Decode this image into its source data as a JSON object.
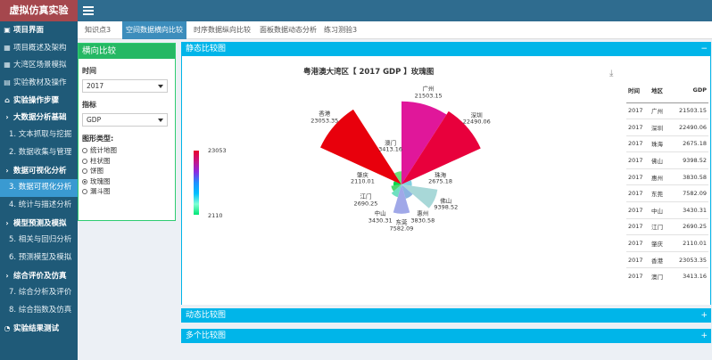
{
  "app": {
    "title": "虚拟仿真实验"
  },
  "sidebar": {
    "items": [
      {
        "label": "项目界面",
        "type": "section",
        "icon": "dashboard-icon"
      },
      {
        "label": "项目概述及架构",
        "type": "item",
        "icon": "grid-icon"
      },
      {
        "label": "大湾区场景模拟",
        "type": "item",
        "icon": "grid-icon"
      },
      {
        "label": "实验教材及操作",
        "type": "item",
        "icon": "image-icon"
      },
      {
        "label": "实验操作步骤",
        "type": "section",
        "icon": "bank-icon"
      },
      {
        "label": "大数据分析基础",
        "type": "section",
        "icon": "chevron-right-icon"
      },
      {
        "label": "1. 文本抓取与挖掘",
        "type": "sub"
      },
      {
        "label": "2. 数据收集与管理",
        "type": "sub"
      },
      {
        "label": "数据可视化分析",
        "type": "section",
        "icon": "chevron-right-icon"
      },
      {
        "label": "3. 数据可视化分析",
        "type": "sub",
        "active": true
      },
      {
        "label": "4. 统计与描述分析",
        "type": "sub"
      },
      {
        "label": "模型预测及模拟",
        "type": "section",
        "icon": "chevron-right-icon"
      },
      {
        "label": "5. 相关与回归分析",
        "type": "sub"
      },
      {
        "label": "6. 预测模型及模拟",
        "type": "sub"
      },
      {
        "label": "综合评价及仿真",
        "type": "section",
        "icon": "chevron-right-icon"
      },
      {
        "label": "7. 综合分析及评价",
        "type": "sub"
      },
      {
        "label": "8. 综合指数及仿真",
        "type": "sub"
      },
      {
        "label": "实验结果测试",
        "type": "section",
        "icon": "clock-icon"
      }
    ]
  },
  "tabs": [
    {
      "label": "知识点3"
    },
    {
      "label": "空间数据横向比较",
      "active": true
    },
    {
      "label": "时序数据纵向比较"
    },
    {
      "label": "面板数据动态分析"
    },
    {
      "label": "练习测验3"
    }
  ],
  "controls": {
    "header": "横向比较",
    "time_label": "时间",
    "time_value": "2017",
    "indicator_label": "指标",
    "indicator_value": "GDP",
    "chart_type_label": "图形类型:",
    "chart_types": [
      {
        "label": "统计地图",
        "selected": false
      },
      {
        "label": "柱状图",
        "selected": false
      },
      {
        "label": "饼图",
        "selected": false
      },
      {
        "label": "玫瑰图",
        "selected": true
      },
      {
        "label": "漏斗图",
        "selected": false
      }
    ]
  },
  "boxes": {
    "static": {
      "title": "静态比较图",
      "toggle": "−"
    },
    "dynamic": {
      "title": "动态比较图",
      "toggle": "+"
    },
    "multi": {
      "title": "多个比较图",
      "toggle": "+"
    }
  },
  "chart_data": {
    "type": "pie",
    "subtype": "rose",
    "title": "粤港澳大湾区【 2017 GDP 】玫瑰图",
    "legend": {
      "max": "23053",
      "min": "2110"
    },
    "slices": [
      {
        "name": "广州",
        "value": 21503.15,
        "color": "#e0179a"
      },
      {
        "name": "深圳",
        "value": 22490.06,
        "color": "#e8003c"
      },
      {
        "name": "珠海",
        "value": 2675.18,
        "color": "#7ecfe0"
      },
      {
        "name": "佛山",
        "value": 9398.52,
        "color": "#a8d8d8"
      },
      {
        "name": "惠州",
        "value": 3830.58,
        "color": "#8ab4e0"
      },
      {
        "name": "东莞",
        "value": 7582.09,
        "color": "#a0a8e8"
      },
      {
        "name": "中山",
        "value": 3430.31,
        "color": "#6fe0c0"
      },
      {
        "name": "江门",
        "value": 2690.25,
        "color": "#4ad86e"
      },
      {
        "name": "肇庆",
        "value": 2110.01,
        "color": "#00d84a"
      },
      {
        "name": "香港",
        "value": 23053.35,
        "color": "#e8000c"
      },
      {
        "name": "澳门",
        "value": 3413.16,
        "color": "#6ee07a"
      }
    ]
  },
  "table": {
    "headers": [
      "时间",
      "地区",
      "GDP"
    ],
    "rows": [
      [
        "2017",
        "广州",
        "21503.15"
      ],
      [
        "2017",
        "深圳",
        "22490.06"
      ],
      [
        "2017",
        "珠海",
        "2675.18"
      ],
      [
        "2017",
        "佛山",
        "9398.52"
      ],
      [
        "2017",
        "惠州",
        "3830.58"
      ],
      [
        "2017",
        "东莞",
        "7582.09"
      ],
      [
        "2017",
        "中山",
        "3430.31"
      ],
      [
        "2017",
        "江门",
        "2690.25"
      ],
      [
        "2017",
        "肇庆",
        "2110.01"
      ],
      [
        "2017",
        "香港",
        "23053.35"
      ],
      [
        "2017",
        "澳门",
        "3413.16"
      ]
    ]
  }
}
